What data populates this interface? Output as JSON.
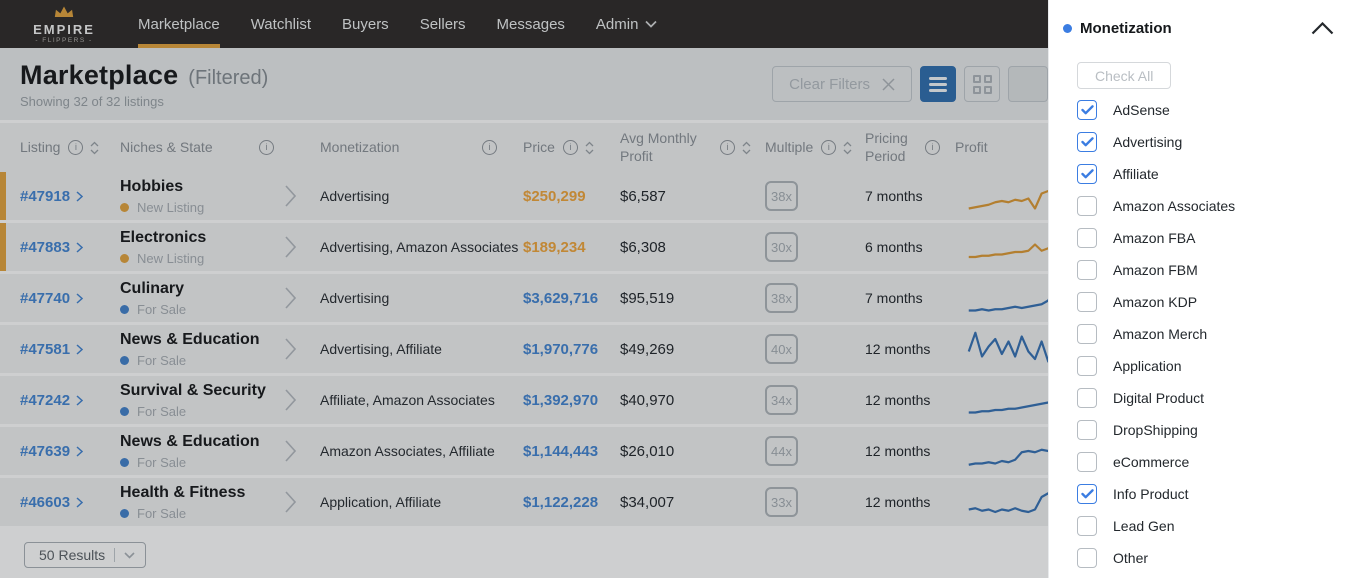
{
  "nav": {
    "logo_title": "EMPIRE",
    "logo_subtitle": "- FLIPPERS -",
    "items": [
      {
        "label": "Marketplace",
        "active": true
      },
      {
        "label": "Watchlist",
        "active": false
      },
      {
        "label": "Buyers",
        "active": false
      },
      {
        "label": "Sellers",
        "active": false
      },
      {
        "label": "Messages",
        "active": false
      },
      {
        "label": "Admin",
        "active": false,
        "dropdown": true
      }
    ]
  },
  "header": {
    "title": "Marketplace",
    "title_suffix": "(Filtered)",
    "subtitle": "Showing 32 of 32 listings",
    "clear_filters_label": "Clear Filters"
  },
  "table": {
    "columns": [
      {
        "label": "Listing",
        "info": true,
        "sort": true
      },
      {
        "label": "Niches & State",
        "info": true,
        "sort": false,
        "spread": true
      },
      {
        "label": "",
        "info": false,
        "sort": false
      },
      {
        "label": "Monetization",
        "info": true,
        "sort": false,
        "spread": true
      },
      {
        "label": "Price",
        "info": true,
        "sort": true
      },
      {
        "label": "Avg Monthly Profit",
        "info": true,
        "sort": true
      },
      {
        "label": "Multiple",
        "info": true,
        "sort": true
      },
      {
        "label": "Pricing Period",
        "info": true,
        "sort": false
      },
      {
        "label": "Profit",
        "info": false,
        "sort": false
      }
    ],
    "rows": [
      {
        "id": "#47918",
        "niche": "Hobbies",
        "state": "New Listing",
        "state_type": "new",
        "monetization": "Advertising",
        "price": "$250,299",
        "avg_monthly_profit": "$6,587",
        "multiple": "38x",
        "pricing_period": "7 months",
        "spark": [
          4,
          5,
          6,
          7,
          9,
          10,
          9,
          11,
          10,
          12,
          4,
          16,
          18,
          17,
          21,
          25,
          22,
          24,
          21,
          26,
          24
        ]
      },
      {
        "id": "#47883",
        "niche": "Electronics",
        "state": "New Listing",
        "state_type": "new",
        "monetization": "Advertising, Amazon Associates",
        "price": "$189,234",
        "avg_monthly_profit": "$6,308",
        "multiple": "30x",
        "pricing_period": "6 months",
        "spark": [
          6,
          6,
          7,
          7,
          8,
          8,
          9,
          10,
          10,
          11,
          16,
          11,
          13,
          17,
          19,
          20,
          20,
          21,
          21,
          22,
          22
        ]
      },
      {
        "id": "#47740",
        "niche": "Culinary",
        "state": "For Sale",
        "state_type": "sale",
        "monetization": "Advertising",
        "price": "$3,629,716",
        "avg_monthly_profit": "$95,519",
        "multiple": "38x",
        "pricing_period": "7 months",
        "spark": [
          4,
          4,
          5,
          4,
          5,
          5,
          6,
          7,
          6,
          7,
          8,
          9,
          12,
          22,
          26,
          23,
          17,
          15,
          20,
          24,
          26
        ]
      },
      {
        "id": "#47581",
        "niche": "News & Education",
        "state": "For Sale",
        "state_type": "sale",
        "monetization": "Advertising, Affiliate",
        "price": "$1,970,776",
        "avg_monthly_profit": "$49,269",
        "multiple": "40x",
        "pricing_period": "12 months",
        "spark": [
          12,
          27,
          8,
          16,
          22,
          10,
          20,
          8,
          24,
          12,
          6,
          20,
          4,
          26,
          14,
          6,
          10,
          8,
          12,
          14,
          16
        ]
      },
      {
        "id": "#47242",
        "niche": "Survival & Security",
        "state": "For Sale",
        "state_type": "sale",
        "monetization": "Affiliate, Amazon Associates",
        "price": "$1,392,970",
        "avg_monthly_profit": "$40,970",
        "multiple": "34x",
        "pricing_period": "12 months",
        "spark": [
          4,
          4,
          5,
          5,
          6,
          6,
          7,
          7,
          8,
          9,
          10,
          11,
          12,
          14,
          15,
          16,
          18,
          20,
          22,
          25,
          27
        ]
      },
      {
        "id": "#47639",
        "niche": "News & Education",
        "state": "For Sale",
        "state_type": "sale",
        "monetization": "Amazon Associates, Affiliate",
        "price": "$1,144,443",
        "avg_monthly_profit": "$26,010",
        "multiple": "44x",
        "pricing_period": "12 months",
        "spark": [
          3,
          4,
          4,
          5,
          4,
          6,
          5,
          7,
          13,
          14,
          13,
          15,
          14,
          18,
          16,
          24,
          27,
          25,
          26,
          24,
          25
        ]
      },
      {
        "id": "#46603",
        "niche": "Health & Fitness",
        "state": "For Sale",
        "state_type": "sale",
        "monetization": "Application, Affiliate",
        "price": "$1,122,228",
        "avg_monthly_profit": "$34,007",
        "multiple": "33x",
        "pricing_period": "12 months",
        "spark": [
          8,
          9,
          7,
          8,
          6,
          8,
          7,
          9,
          7,
          6,
          8,
          18,
          21,
          18,
          20,
          18,
          21,
          19,
          22,
          20,
          21
        ]
      }
    ]
  },
  "panel": {
    "title": "Monetization",
    "check_all_label": "Check All",
    "options": [
      {
        "label": "AdSense",
        "checked": true
      },
      {
        "label": "Advertising",
        "checked": true
      },
      {
        "label": "Affiliate",
        "checked": true
      },
      {
        "label": "Amazon Associates",
        "checked": false
      },
      {
        "label": "Amazon FBA",
        "checked": false
      },
      {
        "label": "Amazon FBM",
        "checked": false
      },
      {
        "label": "Amazon KDP",
        "checked": false
      },
      {
        "label": "Amazon Merch",
        "checked": false
      },
      {
        "label": "Application",
        "checked": false
      },
      {
        "label": "Digital Product",
        "checked": false
      },
      {
        "label": "DropShipping",
        "checked": false
      },
      {
        "label": "eCommerce",
        "checked": false
      },
      {
        "label": "Info Product",
        "checked": true
      },
      {
        "label": "Lead Gen",
        "checked": false
      },
      {
        "label": "Other",
        "checked": false
      }
    ]
  },
  "footer": {
    "results_label": "50 Results"
  },
  "colors": {
    "accent_orange": "#e2a33d",
    "link_blue": "#4285d2",
    "checkbox_blue": "#3b7de2",
    "status_new": "#e2a33d",
    "status_sale": "#4282cb",
    "price_new": "#efa53c",
    "price_sale": "#4285d2",
    "spark_new": "#dd9a35",
    "spark_sale": "#3672b4",
    "active_view_bg": "#2f6fb0"
  }
}
